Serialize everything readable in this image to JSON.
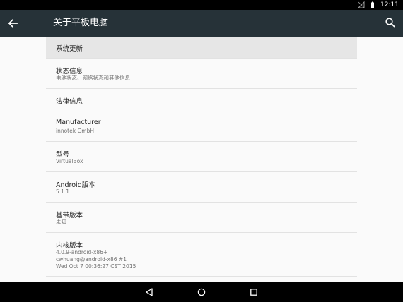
{
  "status_bar": {
    "time": "12:11",
    "icons": [
      "no-signal-icon",
      "battery-icon"
    ]
  },
  "toolbar": {
    "title": "关于平板电脑",
    "back_icon": "arrow-back-icon",
    "search_icon": "search-icon"
  },
  "items": [
    {
      "title": "系统更新"
    },
    {
      "title": "状态信息",
      "subtitle": "电池状态、网络状态和其他信息"
    },
    {
      "title": "法律信息"
    },
    {
      "title": "Manufacturer",
      "subtitle": "innotek GmbH"
    },
    {
      "title": "型号",
      "subtitle": "VirtualBox"
    },
    {
      "title": "Android版本",
      "subtitle": "5.1.1"
    },
    {
      "title": "基带版本",
      "subtitle": "未知"
    },
    {
      "title": "内核版本",
      "subtitle_lines": [
        "4.0.9-android-x86+",
        "cwhuang@android-x86 #1",
        "Wed Oct 7 00:36:27 CST 2015"
      ]
    }
  ],
  "nav_bar": {
    "icons": [
      "back-triangle-icon",
      "home-circle-icon",
      "recents-square-icon"
    ]
  }
}
